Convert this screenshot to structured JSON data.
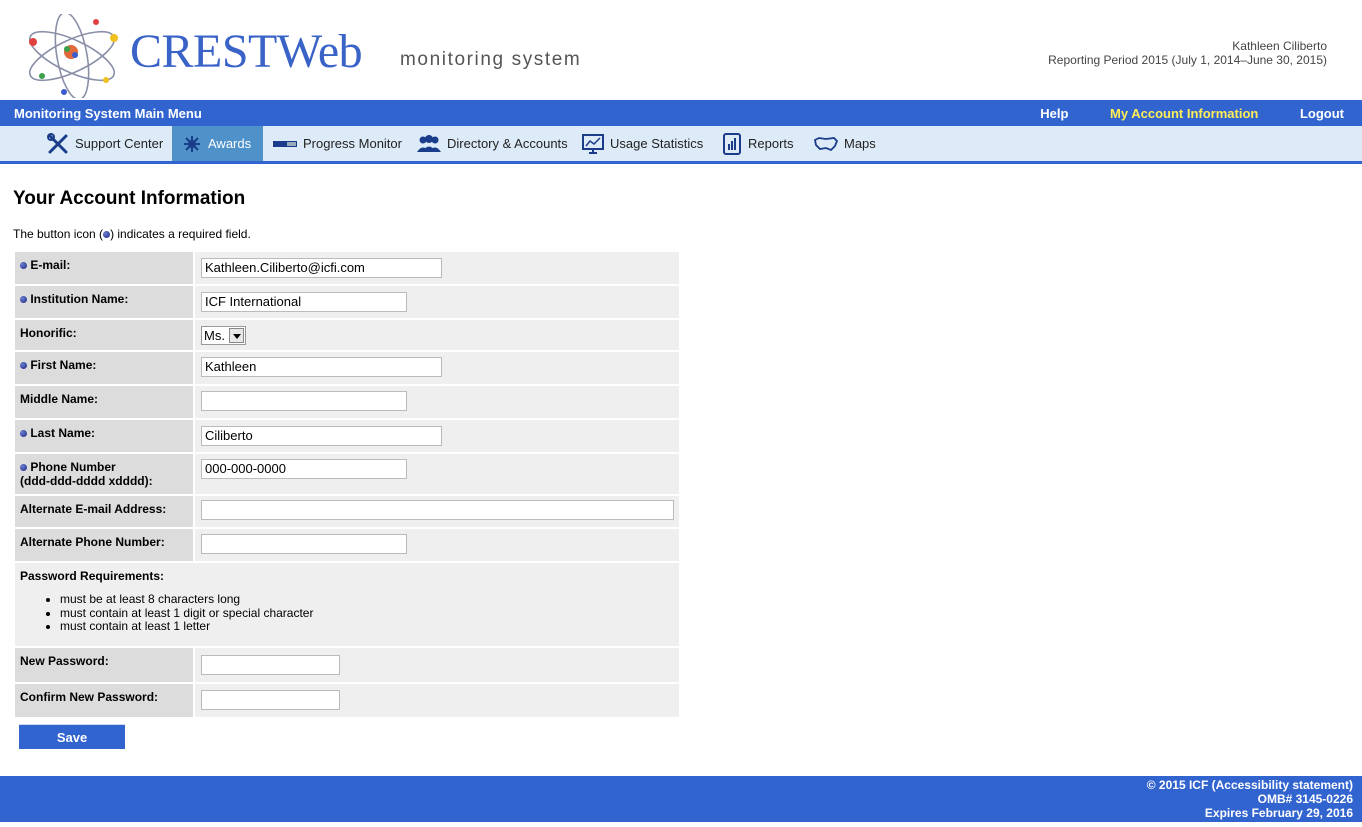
{
  "header": {
    "logo_text": "CRESTWeb",
    "logo_subtitle": "monitoring system",
    "user_name": "Kathleen Ciliberto",
    "reporting_period": "Reporting Period 2015 (July 1, 2014–June 30, 2015)"
  },
  "main_menu": {
    "title": "Monitoring System Main Menu",
    "help": "Help",
    "my_account": "My Account Information",
    "logout": "Logout"
  },
  "nav": [
    {
      "label": "Support Center",
      "icon": "tools-icon"
    },
    {
      "label": "Awards",
      "icon": "awards-icon",
      "active": true
    },
    {
      "label": "Progress Monitor",
      "icon": "progress-bar-icon"
    },
    {
      "label": "Directory & Accounts",
      "icon": "users-icon"
    },
    {
      "label": "Usage Statistics",
      "icon": "chart-monitor-icon"
    },
    {
      "label": "Reports",
      "icon": "report-icon"
    },
    {
      "label": "Maps",
      "icon": "map-icon"
    }
  ],
  "page": {
    "title": "Your Account Information",
    "required_note_before": "The button icon (",
    "required_note_after": ") indicates a required field."
  },
  "form": {
    "email": {
      "label": "E-mail:",
      "value": "Kathleen.Ciliberto@icfi.com"
    },
    "institution": {
      "label": "Institution Name:",
      "value": "ICF International"
    },
    "honorific": {
      "label": "Honorific:",
      "value": "Ms."
    },
    "first_name": {
      "label": "First Name:",
      "value": "Kathleen"
    },
    "middle_name": {
      "label": "Middle Name:",
      "value": ""
    },
    "last_name": {
      "label": "Last Name:",
      "value": "Ciliberto"
    },
    "phone": {
      "label": "Phone Number",
      "label2": "(ddd-ddd-dddd xdddd):",
      "value": "000-000-0000"
    },
    "alt_email": {
      "label": "Alternate E-mail Address:",
      "value": ""
    },
    "alt_phone": {
      "label": "Alternate Phone Number:",
      "value": ""
    },
    "pw_requirements": {
      "label": "Password Requirements:",
      "items": [
        "must be at least 8 characters long",
        "must contain at least 1 digit or special character",
        "must contain at least 1 letter"
      ]
    },
    "new_password": {
      "label": "New Password:"
    },
    "confirm_password": {
      "label": "Confirm New Password:"
    },
    "save": "Save"
  },
  "footer": {
    "line1": "© 2015 ICF (Accessibility statement)",
    "line2": "OMB# 3145-0226",
    "line3": "Expires February 29, 2016"
  },
  "colors": {
    "primary_blue": "#3264cf",
    "active_tab": "#4f92c9",
    "nav_bg": "#dcebf7",
    "highlight_link": "#ffee55"
  }
}
